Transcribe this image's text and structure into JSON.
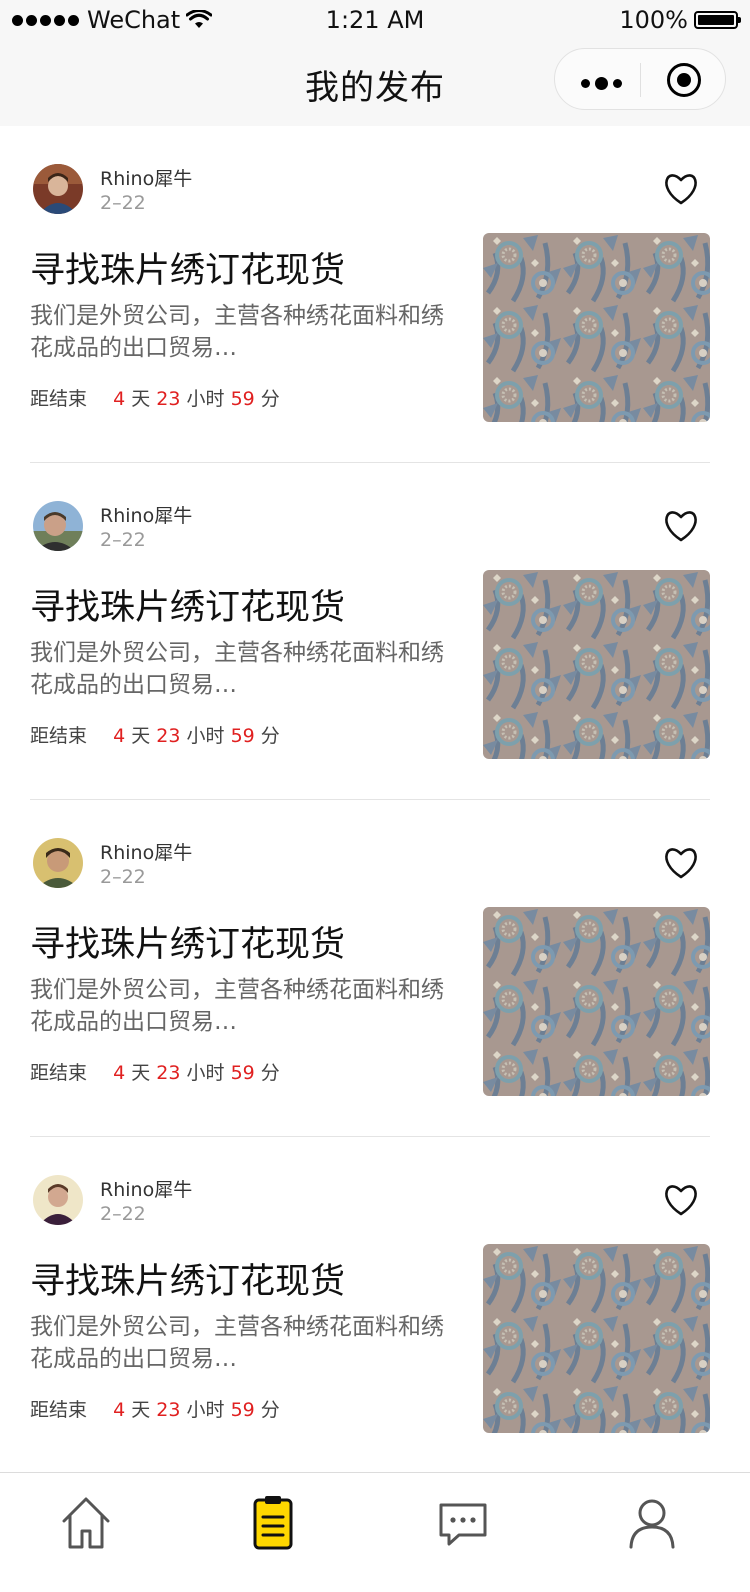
{
  "status_bar": {
    "carrier": "WeChat",
    "time": "1:21 AM",
    "battery": "100%"
  },
  "nav": {
    "title": "我的发布"
  },
  "colors": {
    "accent_red": "#e02020",
    "tab_active": "#ffd800"
  },
  "posts": [
    {
      "author": "Rhino犀牛",
      "date": "2–22",
      "title": "寻找珠片绣订花现货",
      "desc": "我们是外贸公司，主营各种绣花面料和绣花成品的出口贸易…",
      "countdown": {
        "prefix": "距结束",
        "days": "4",
        "days_unit": "天",
        "hours": "23",
        "hours_unit": "小时",
        "minutes": "59",
        "minutes_unit": "分"
      }
    },
    {
      "author": "Rhino犀牛",
      "date": "2–22",
      "title": "寻找珠片绣订花现货",
      "desc": "我们是外贸公司，主营各种绣花面料和绣花成品的出口贸易…",
      "countdown": {
        "prefix": "距结束",
        "days": "4",
        "days_unit": "天",
        "hours": "23",
        "hours_unit": "小时",
        "minutes": "59",
        "minutes_unit": "分"
      }
    },
    {
      "author": "Rhino犀牛",
      "date": "2–22",
      "title": "寻找珠片绣订花现货",
      "desc": "我们是外贸公司，主营各种绣花面料和绣花成品的出口贸易…",
      "countdown": {
        "prefix": "距结束",
        "days": "4",
        "days_unit": "天",
        "hours": "23",
        "hours_unit": "小时",
        "minutes": "59",
        "minutes_unit": "分"
      }
    },
    {
      "author": "Rhino犀牛",
      "date": "2–22",
      "title": "寻找珠片绣订花现货",
      "desc": "我们是外贸公司，主营各种绣花面料和绣花成品的出口贸易…",
      "countdown": {
        "prefix": "距结束",
        "days": "4",
        "days_unit": "天",
        "hours": "23",
        "hours_unit": "小时",
        "minutes": "59",
        "minutes_unit": "分"
      }
    }
  ],
  "tabbar": {
    "tabs": [
      {
        "icon": "home-icon",
        "active": false
      },
      {
        "icon": "clipboard-icon",
        "active": true
      },
      {
        "icon": "chat-icon",
        "active": false
      },
      {
        "icon": "user-icon",
        "active": false
      }
    ]
  }
}
